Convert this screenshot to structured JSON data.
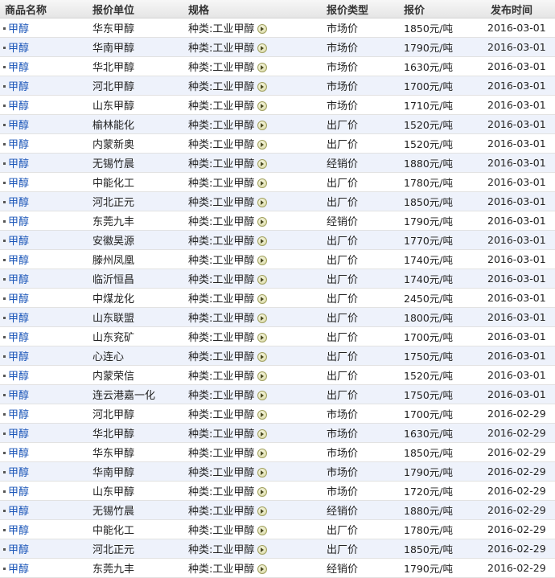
{
  "headers": [
    "商品名称",
    "报价单位",
    "规格",
    "报价类型",
    "报价",
    "发布时间"
  ],
  "rows": [
    {
      "name": "甲醇",
      "unit": "华东甲醇",
      "spec": "种类:工业甲醇",
      "type": "市场价",
      "price": "1850元/吨",
      "date": "2016-03-01"
    },
    {
      "name": "甲醇",
      "unit": "华南甲醇",
      "spec": "种类:工业甲醇",
      "type": "市场价",
      "price": "1790元/吨",
      "date": "2016-03-01"
    },
    {
      "name": "甲醇",
      "unit": "华北甲醇",
      "spec": "种类:工业甲醇",
      "type": "市场价",
      "price": "1630元/吨",
      "date": "2016-03-01"
    },
    {
      "name": "甲醇",
      "unit": "河北甲醇",
      "spec": "种类:工业甲醇",
      "type": "市场价",
      "price": "1700元/吨",
      "date": "2016-03-01"
    },
    {
      "name": "甲醇",
      "unit": "山东甲醇",
      "spec": "种类:工业甲醇",
      "type": "市场价",
      "price": "1710元/吨",
      "date": "2016-03-01"
    },
    {
      "name": "甲醇",
      "unit": "榆林能化",
      "spec": "种类:工业甲醇",
      "type": "出厂价",
      "price": "1520元/吨",
      "date": "2016-03-01"
    },
    {
      "name": "甲醇",
      "unit": "内蒙新奥",
      "spec": "种类:工业甲醇",
      "type": "出厂价",
      "price": "1520元/吨",
      "date": "2016-03-01"
    },
    {
      "name": "甲醇",
      "unit": "无锡竹晨",
      "spec": "种类:工业甲醇",
      "type": "经销价",
      "price": "1880元/吨",
      "date": "2016-03-01"
    },
    {
      "name": "甲醇",
      "unit": "中能化工",
      "spec": "种类:工业甲醇",
      "type": "出厂价",
      "price": "1780元/吨",
      "date": "2016-03-01"
    },
    {
      "name": "甲醇",
      "unit": "河北正元",
      "spec": "种类:工业甲醇",
      "type": "出厂价",
      "price": "1850元/吨",
      "date": "2016-03-01"
    },
    {
      "name": "甲醇",
      "unit": "东莞九丰",
      "spec": "种类:工业甲醇",
      "type": "经销价",
      "price": "1790元/吨",
      "date": "2016-03-01"
    },
    {
      "name": "甲醇",
      "unit": "安徽昊源",
      "spec": "种类:工业甲醇",
      "type": "出厂价",
      "price": "1770元/吨",
      "date": "2016-03-01"
    },
    {
      "name": "甲醇",
      "unit": "滕州凤凰",
      "spec": "种类:工业甲醇",
      "type": "出厂价",
      "price": "1740元/吨",
      "date": "2016-03-01"
    },
    {
      "name": "甲醇",
      "unit": "临沂恒昌",
      "spec": "种类:工业甲醇",
      "type": "出厂价",
      "price": "1740元/吨",
      "date": "2016-03-01"
    },
    {
      "name": "甲醇",
      "unit": "中煤龙化",
      "spec": "种类:工业甲醇",
      "type": "出厂价",
      "price": "2450元/吨",
      "date": "2016-03-01"
    },
    {
      "name": "甲醇",
      "unit": "山东联盟",
      "spec": "种类:工业甲醇",
      "type": "出厂价",
      "price": "1800元/吨",
      "date": "2016-03-01"
    },
    {
      "name": "甲醇",
      "unit": "山东兖矿",
      "spec": "种类:工业甲醇",
      "type": "出厂价",
      "price": "1700元/吨",
      "date": "2016-03-01"
    },
    {
      "name": "甲醇",
      "unit": "心连心",
      "spec": "种类:工业甲醇",
      "type": "出厂价",
      "price": "1750元/吨",
      "date": "2016-03-01"
    },
    {
      "name": "甲醇",
      "unit": "内蒙荣信",
      "spec": "种类:工业甲醇",
      "type": "出厂价",
      "price": "1520元/吨",
      "date": "2016-03-01"
    },
    {
      "name": "甲醇",
      "unit": "连云港嘉一化",
      "spec": "种类:工业甲醇",
      "type": "出厂价",
      "price": "1750元/吨",
      "date": "2016-03-01"
    },
    {
      "name": "甲醇",
      "unit": "河北甲醇",
      "spec": "种类:工业甲醇",
      "type": "市场价",
      "price": "1700元/吨",
      "date": "2016-02-29"
    },
    {
      "name": "甲醇",
      "unit": "华北甲醇",
      "spec": "种类:工业甲醇",
      "type": "市场价",
      "price": "1630元/吨",
      "date": "2016-02-29"
    },
    {
      "name": "甲醇",
      "unit": "华东甲醇",
      "spec": "种类:工业甲醇",
      "type": "市场价",
      "price": "1850元/吨",
      "date": "2016-02-29"
    },
    {
      "name": "甲醇",
      "unit": "华南甲醇",
      "spec": "种类:工业甲醇",
      "type": "市场价",
      "price": "1790元/吨",
      "date": "2016-02-29"
    },
    {
      "name": "甲醇",
      "unit": "山东甲醇",
      "spec": "种类:工业甲醇",
      "type": "市场价",
      "price": "1720元/吨",
      "date": "2016-02-29"
    },
    {
      "name": "甲醇",
      "unit": "无锡竹晨",
      "spec": "种类:工业甲醇",
      "type": "经销价",
      "price": "1880元/吨",
      "date": "2016-02-29"
    },
    {
      "name": "甲醇",
      "unit": "中能化工",
      "spec": "种类:工业甲醇",
      "type": "出厂价",
      "price": "1780元/吨",
      "date": "2016-02-29"
    },
    {
      "name": "甲醇",
      "unit": "河北正元",
      "spec": "种类:工业甲醇",
      "type": "出厂价",
      "price": "1850元/吨",
      "date": "2016-02-29"
    },
    {
      "name": "甲醇",
      "unit": "东莞九丰",
      "spec": "种类:工业甲醇",
      "type": "经销价",
      "price": "1790元/吨",
      "date": "2016-02-29"
    }
  ]
}
